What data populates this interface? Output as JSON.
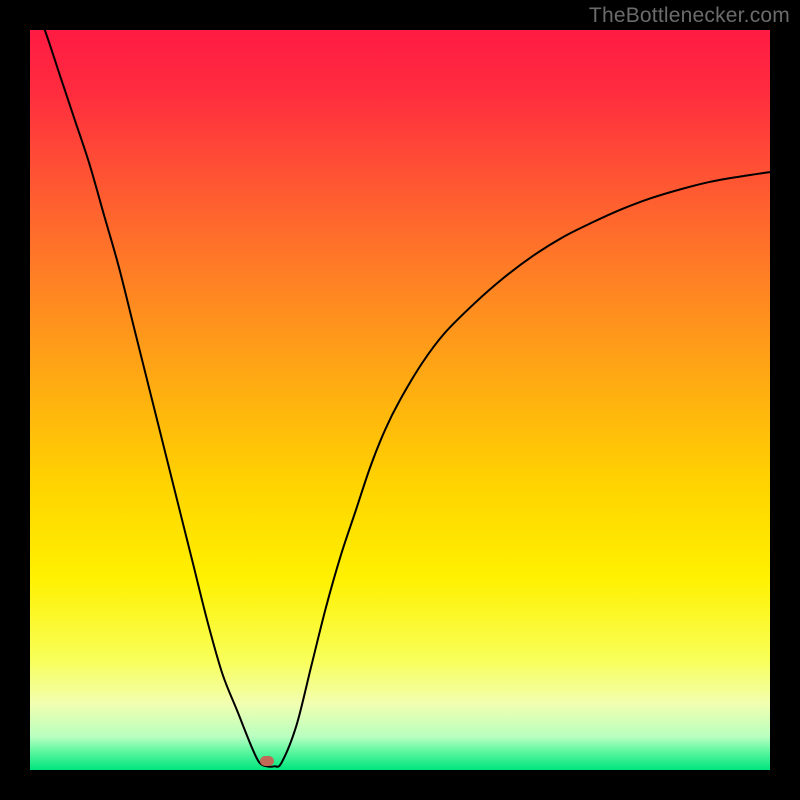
{
  "watermark": {
    "text": "TheBottlenecker.com"
  },
  "chart_data": {
    "type": "line",
    "title": "",
    "xlabel": "",
    "ylabel": "",
    "xlim": [
      0,
      100
    ],
    "ylim": [
      0,
      100
    ],
    "grid": false,
    "legend": false,
    "background_gradient": {
      "direction": "vertical",
      "stops": [
        {
          "pos": 0.0,
          "color": "#ff1b43"
        },
        {
          "pos": 0.08,
          "color": "#ff2b3f"
        },
        {
          "pos": 0.2,
          "color": "#ff5433"
        },
        {
          "pos": 0.35,
          "color": "#ff8523"
        },
        {
          "pos": 0.5,
          "color": "#ffb20f"
        },
        {
          "pos": 0.62,
          "color": "#ffd500"
        },
        {
          "pos": 0.74,
          "color": "#fff100"
        },
        {
          "pos": 0.85,
          "color": "#f8ff58"
        },
        {
          "pos": 0.91,
          "color": "#f2ffb0"
        },
        {
          "pos": 0.955,
          "color": "#b8ffc0"
        },
        {
          "pos": 0.975,
          "color": "#5cf7a0"
        },
        {
          "pos": 1.0,
          "color": "#00e57d"
        }
      ]
    },
    "series": [
      {
        "name": "bottleneck-curve",
        "color": "#000000",
        "stroke_width": 2,
        "x": [
          0,
          2,
          4,
          6,
          8,
          10,
          12,
          14,
          16,
          18,
          20,
          22,
          24,
          26,
          28,
          30,
          31,
          32,
          33,
          34,
          36,
          38,
          40,
          42,
          44,
          46,
          48,
          50,
          53,
          56,
          60,
          64,
          68,
          72,
          76,
          80,
          84,
          88,
          92,
          96,
          100
        ],
        "y": [
          105,
          100,
          94,
          88,
          82,
          75,
          68,
          60,
          52,
          44,
          36,
          28,
          20,
          13,
          8,
          3,
          1,
          0.5,
          0.5,
          1,
          6,
          14,
          22,
          29,
          35,
          41,
          46,
          50,
          55,
          59,
          63,
          66.5,
          69.5,
          72,
          74,
          75.8,
          77.3,
          78.5,
          79.5,
          80.2,
          80.8
        ]
      }
    ],
    "marker": {
      "name": "optimal-point",
      "x": 32,
      "y": 1.2,
      "color": "#c06a57"
    }
  }
}
